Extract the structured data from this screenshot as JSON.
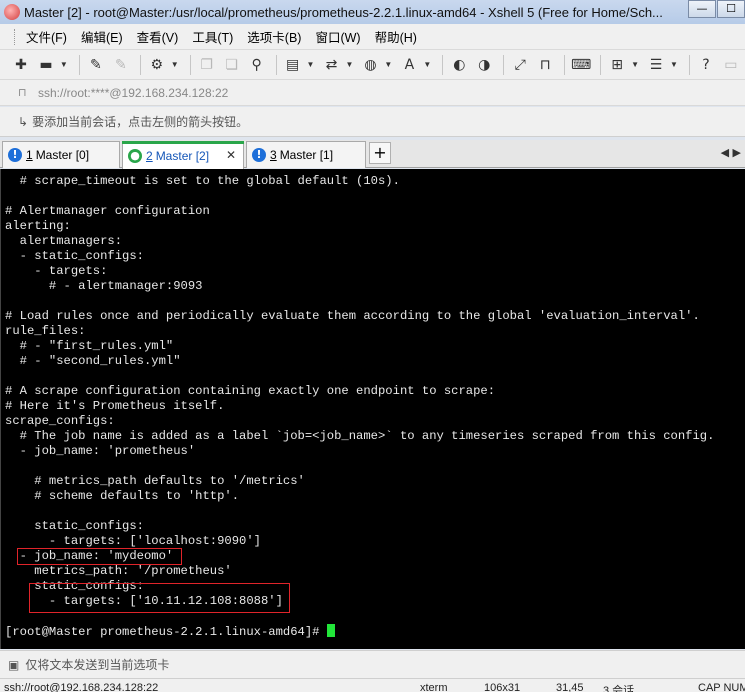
{
  "window": {
    "title": "Master [2] - root@Master:/usr/local/prometheus/prometheus-2.2.1.linux-amd64 - Xshell 5 (Free for Home/Sch...",
    "minimize_glyph": "—",
    "maximize_glyph": "☐"
  },
  "menu": {
    "items": [
      {
        "label": "文件(F)"
      },
      {
        "label": "编辑(E)"
      },
      {
        "label": "查看(V)"
      },
      {
        "label": "工具(T)"
      },
      {
        "label": "选项卡(B)"
      },
      {
        "label": "窗口(W)"
      },
      {
        "label": "帮助(H)"
      }
    ]
  },
  "toolbar": {
    "icons": [
      "new-session-icon",
      "open-folder-icon",
      "reconnect-icon",
      "disconnect-icon",
      "properties-icon",
      "copy-icon",
      "paste-icon",
      "find-icon",
      "print-icon",
      "transfer-icon",
      "globe-icon",
      "font-icon",
      "xftp-icon",
      "xmanager-icon",
      "fullscreen-icon",
      "lock-icon",
      "keyboard-icon",
      "new-tab-icon",
      "help-icon",
      "chat-icon"
    ]
  },
  "address": {
    "text": "ssh://root:****@192.168.234.128:22"
  },
  "hint": {
    "text": "要添加当前会话，点击左侧的箭头按钮。"
  },
  "tabs": [
    {
      "num": "1",
      "label": "Master [0]",
      "active": false
    },
    {
      "num": "2",
      "label": "Master [2]",
      "active": true
    },
    {
      "num": "3",
      "label": "Master [1]",
      "active": false
    }
  ],
  "tab_add_label": "+",
  "tab_nav": "◀ ▶",
  "terminal": {
    "lines": [
      "  # scrape_timeout is set to the global default (10s).",
      "",
      "# Alertmanager configuration",
      "alerting:",
      "  alertmanagers:",
      "  - static_configs:",
      "    - targets:",
      "      # - alertmanager:9093",
      "",
      "# Load rules once and periodically evaluate them according to the global 'evaluation_interval'.",
      "rule_files:",
      "  # - \"first_rules.yml\"",
      "  # - \"second_rules.yml\"",
      "",
      "# A scrape configuration containing exactly one endpoint to scrape:",
      "# Here it's Prometheus itself.",
      "scrape_configs:",
      "  # The job name is added as a label `job=<job_name>` to any timeseries scraped from this config.",
      "  - job_name: 'prometheus'",
      "",
      "    # metrics_path defaults to '/metrics'",
      "    # scheme defaults to 'http'.",
      "",
      "    static_configs:",
      "      - targets: ['localhost:9090']",
      "  - job_name: 'mydeomo'",
      "    metrics_path: '/prometheus'",
      "    static_configs:",
      "      - targets: ['10.11.12.108:8088']",
      "",
      "[root@Master prometheus-2.2.1.linux-amd64]# "
    ],
    "cursor_color": "#22e63a",
    "highlight_color": "#e0242a"
  },
  "sendbar": {
    "text": "仅将文本发送到当前选项卡"
  },
  "status": {
    "connection": "ssh://root@192.168.234.128:22",
    "term": "xterm",
    "size": "106x31",
    "position": "31,45",
    "sessions": "3 会话",
    "caps": "CAP NUM"
  }
}
